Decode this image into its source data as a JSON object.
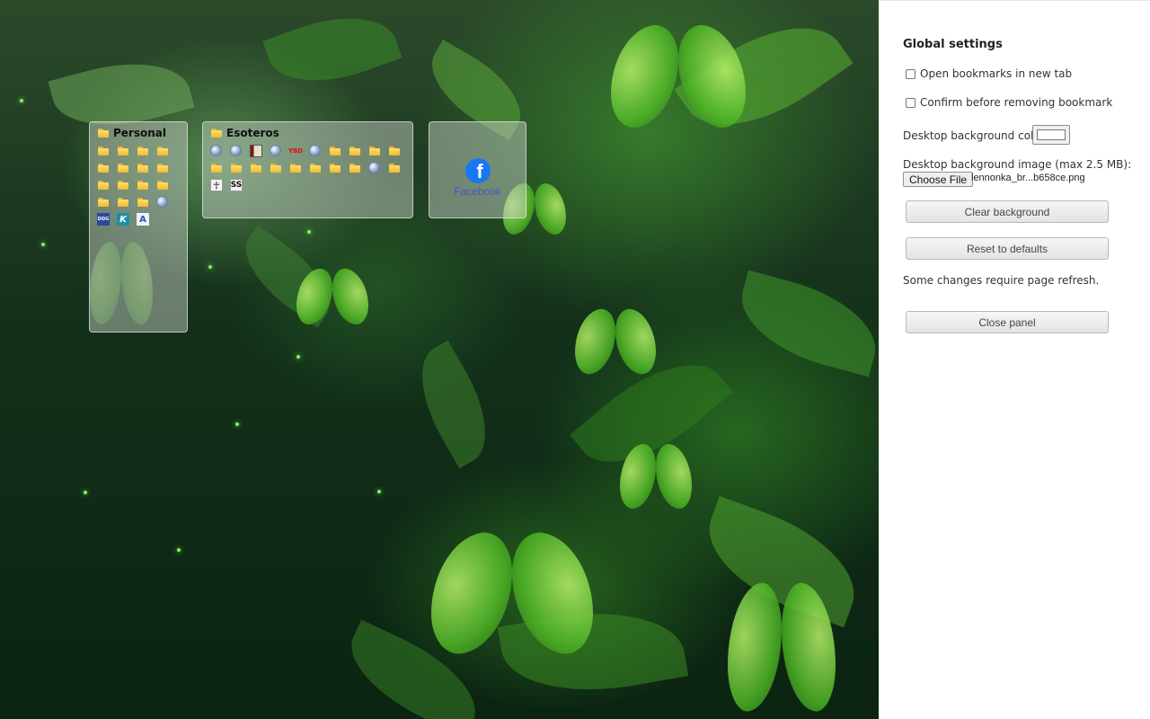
{
  "desktop": {
    "folders": [
      {
        "title": "Personal",
        "icons": [
          "folder-icon",
          "folder-icon",
          "folder-icon",
          "folder-icon",
          "folder-icon",
          "folder-icon",
          "folder-icon",
          "folder-icon",
          "folder-icon",
          "folder-icon",
          "folder-icon",
          "folder-icon",
          "folder-icon",
          "folder-icon",
          "folder-icon",
          "globe-icon",
          "ddg-icon",
          "k-icon",
          "a-icon"
        ]
      },
      {
        "title": "Esoteros",
        "icons": [
          "globe-icon",
          "globe-icon",
          "book-icon",
          "globe-icon",
          "red-text-icon",
          "globe-icon",
          "folder-icon",
          "folder-icon",
          "folder-icon",
          "folder-icon",
          "folder-icon",
          "folder-icon",
          "folder-icon",
          "folder-icon",
          "folder-icon",
          "folder-icon",
          "folder-icon",
          "folder-icon",
          "globe-icon",
          "folder-icon",
          "ankh-icon",
          "ss-icon"
        ]
      }
    ],
    "facebook": {
      "label": "Facebook",
      "glyph": "f",
      "color": "#1877f2"
    },
    "text_icons": {
      "red": "YBD",
      "ss": "SS",
      "ankh": "☥",
      "k": "K",
      "a": "A",
      "ddg": "DDG"
    }
  },
  "panel": {
    "title": "Global settings",
    "open_new_tab_label": "Open bookmarks in new tab",
    "open_new_tab_checked": false,
    "confirm_remove_label": "Confirm before removing bookmark",
    "confirm_remove_checked": false,
    "bg_color_label": "Desktop background color:",
    "bg_color_value": "#ffffff",
    "bg_image_label": "Desktop background image (max 2.5 MB):",
    "choose_file_label": "Choose File",
    "file_name": "lennonka_br...b658ce.png",
    "clear_background_label": "Clear background",
    "reset_defaults_label": "Reset to defaults",
    "refresh_note": "Some changes require page refresh.",
    "close_panel_label": "Close panel"
  }
}
